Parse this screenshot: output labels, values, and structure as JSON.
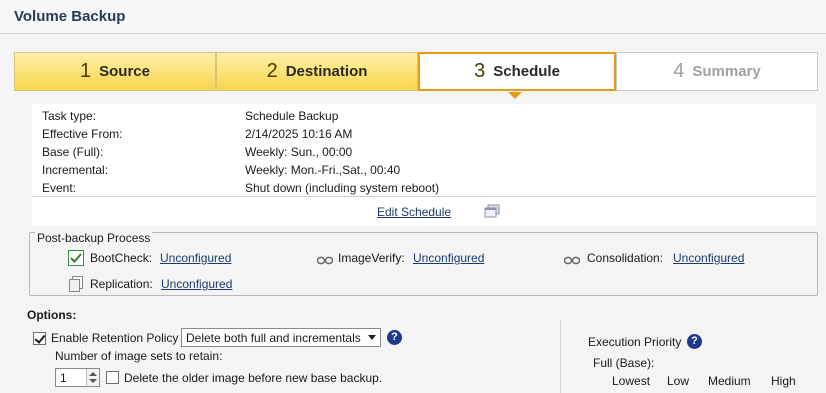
{
  "window": {
    "title": "Volume Backup"
  },
  "wizard": {
    "steps": [
      {
        "num": "1",
        "label": "Source"
      },
      {
        "num": "2",
        "label": "Destination"
      },
      {
        "num": "3",
        "label": "Schedule"
      },
      {
        "num": "4",
        "label": "Summary"
      }
    ],
    "current": 3
  },
  "summary": {
    "rows": [
      {
        "key": "Task type:",
        "value": "Schedule Backup"
      },
      {
        "key": "Effective From:",
        "value": "2/14/2025 10:16 AM"
      },
      {
        "key": "Base (Full):",
        "value": "Weekly: Sun., 00:00"
      },
      {
        "key": "Incremental:",
        "value": "Weekly: Mon.-Fri.,Sat., 00:40"
      },
      {
        "key": "Event:",
        "value": "Shut down (including system reboot)"
      }
    ],
    "edit_link": "Edit Schedule"
  },
  "post_backup": {
    "legend": "Post-backup Process",
    "bootcheck_label": "BootCheck:",
    "bootcheck_value": "Unconfigured",
    "imageverify_label": "ImageVerify:",
    "imageverify_value": "Unconfigured",
    "consolidation_label": "Consolidation:",
    "consolidation_value": "Unconfigured",
    "replication_label": "Replication:",
    "replication_value": "Unconfigured"
  },
  "options": {
    "heading": "Options:",
    "retention_label": "Enable Retention Policy",
    "retention_checked": true,
    "retention_mode": "Delete both full and incrementals",
    "image_sets_label": "Number of image sets to retain:",
    "image_sets_value": "1",
    "delete_older_label": "Delete the older image before new base backup.",
    "delete_older_checked": false
  },
  "execution_priority": {
    "title": "Execution Priority",
    "full_base_label": "Full (Base):",
    "levels": [
      "Lowest",
      "Low",
      "Medium",
      "High"
    ]
  },
  "icons": {
    "help": "?",
    "accent": "#e89a1c",
    "link_color": "#1a3b6e"
  }
}
